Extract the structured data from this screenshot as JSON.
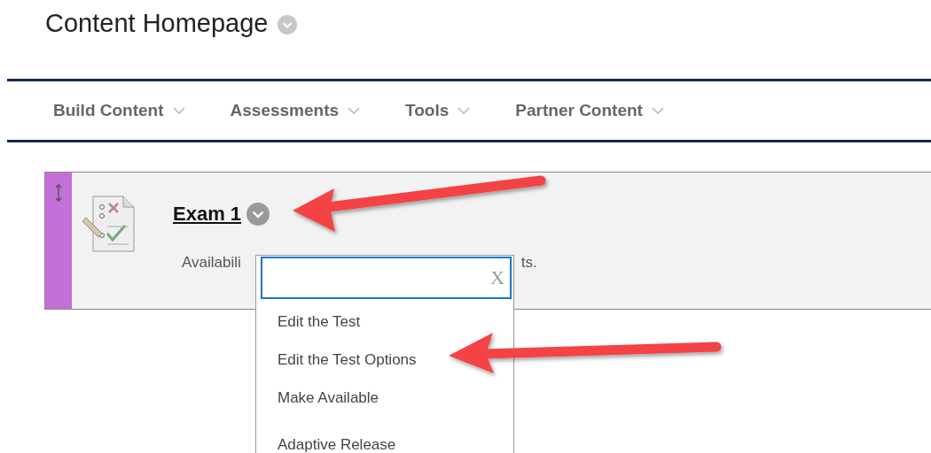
{
  "page_title": "Content Homepage",
  "nav": [
    {
      "label": "Build Content"
    },
    {
      "label": "Assessments"
    },
    {
      "label": "Tools"
    },
    {
      "label": "Partner Content"
    }
  ],
  "item": {
    "title": "Exam 1",
    "description_start": "Availabili",
    "description_end": "ts."
  },
  "menu": {
    "close_label": "X",
    "items": [
      {
        "label": "Edit the Test"
      },
      {
        "label": "Edit the Test Options"
      },
      {
        "label": "Make Available"
      },
      {
        "label": "Adaptive Release"
      }
    ]
  }
}
